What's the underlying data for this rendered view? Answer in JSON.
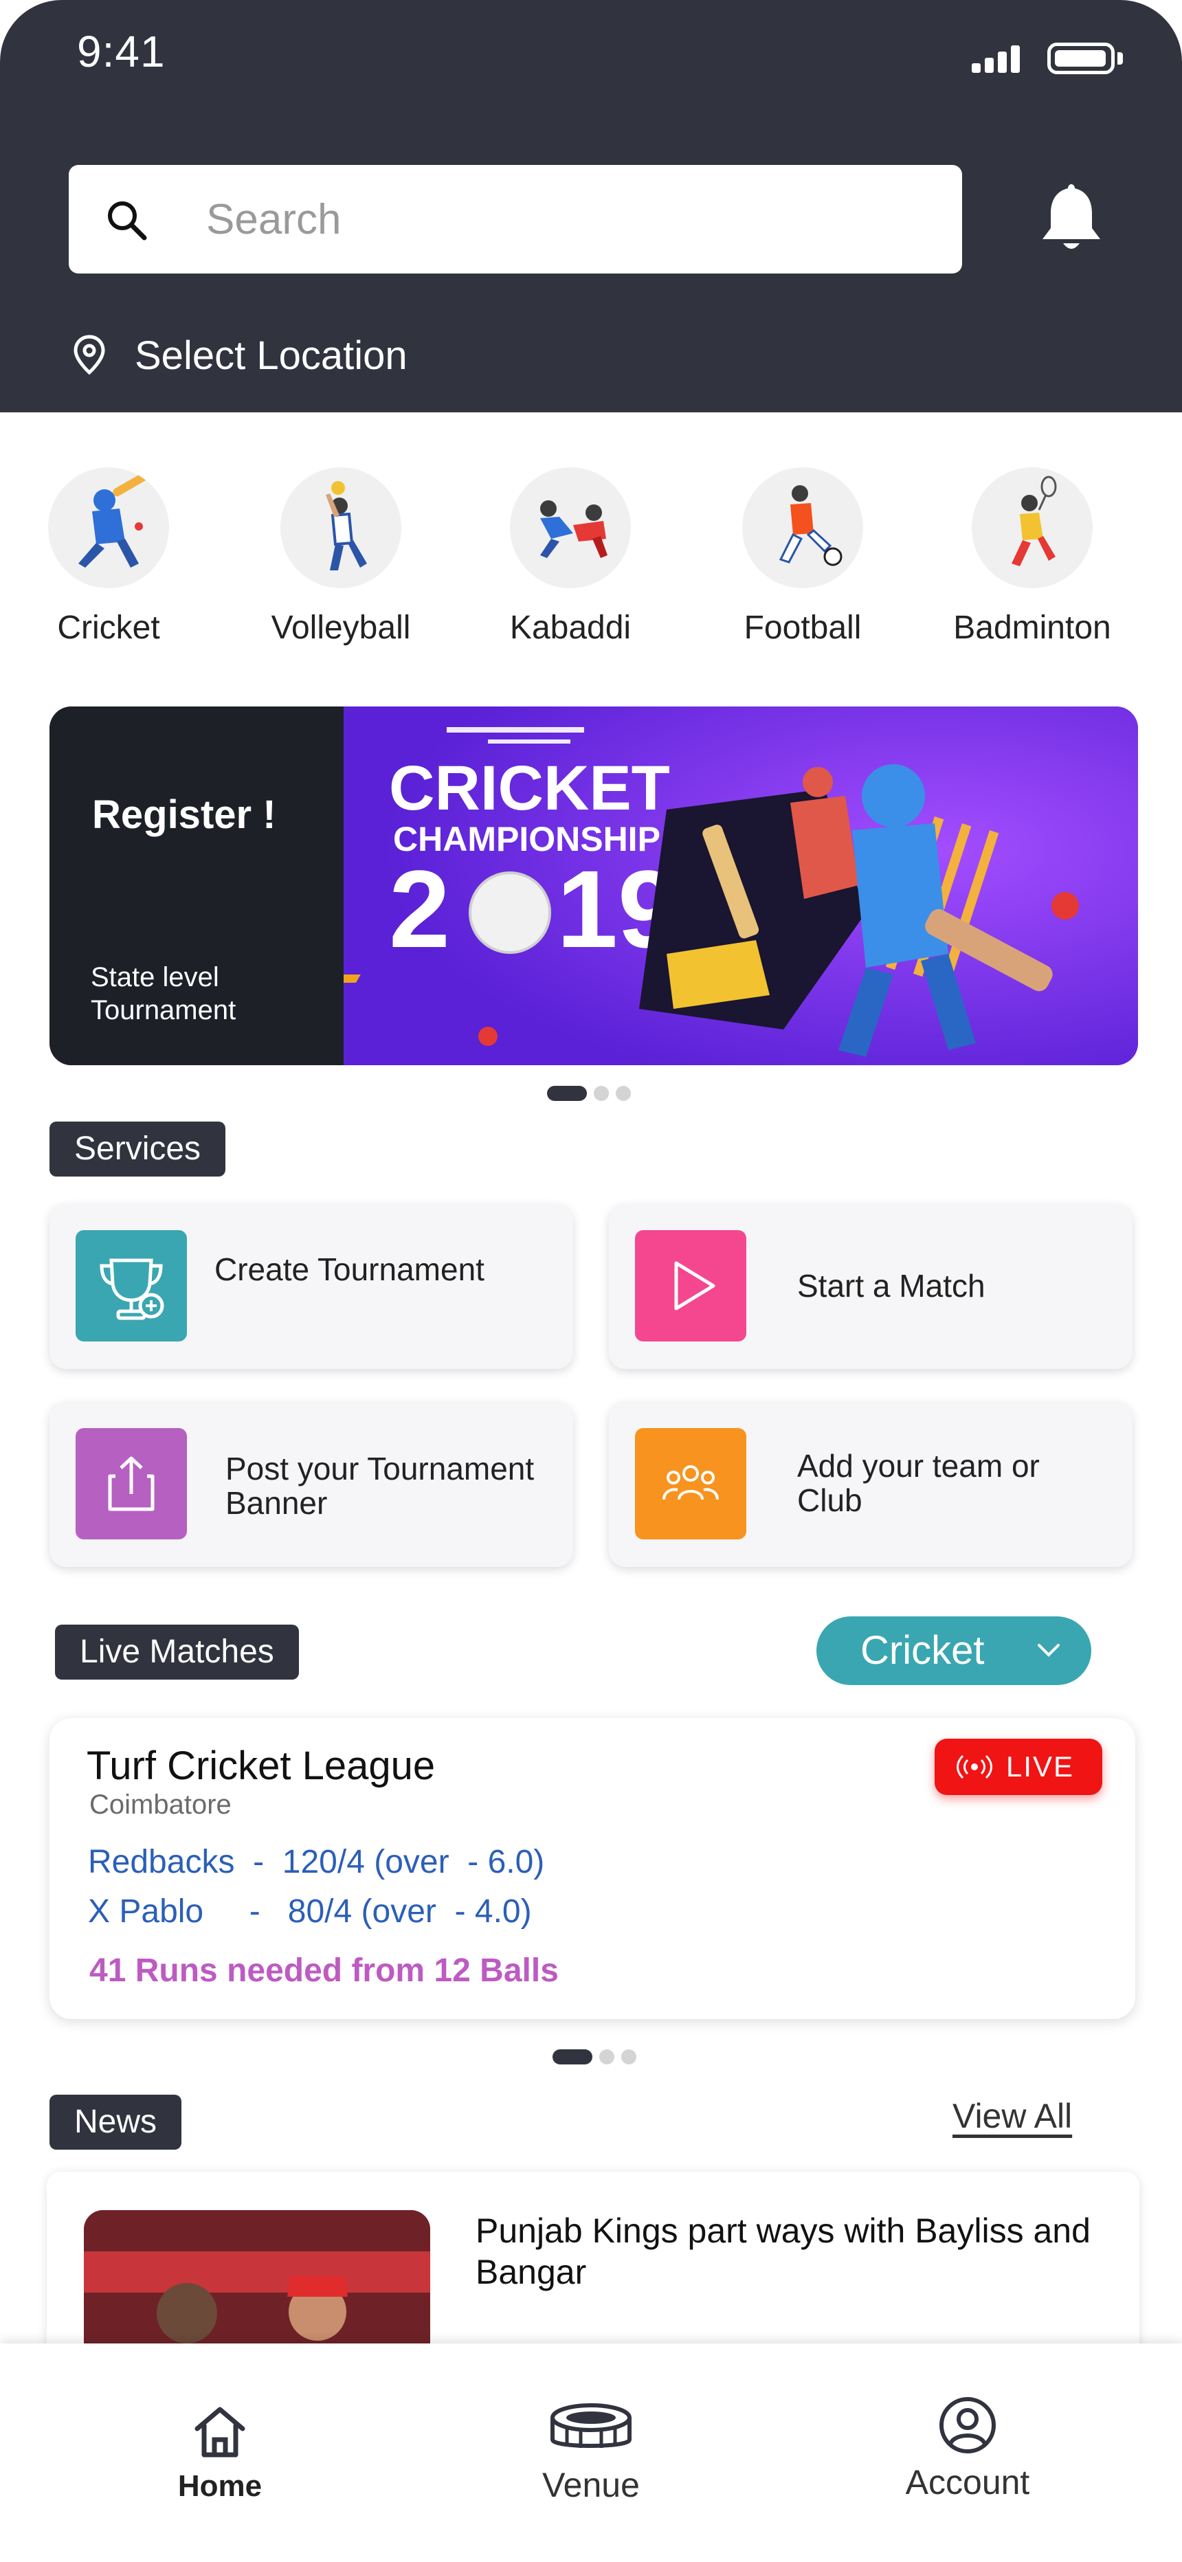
{
  "status_bar": {
    "time": "9:41"
  },
  "header": {
    "search_placeholder": "Search",
    "location_label": "Select Location"
  },
  "sports": [
    {
      "label": "Cricket",
      "icon": "cricket-player-icon"
    },
    {
      "label": "Volleyball",
      "icon": "volleyball-player-icon"
    },
    {
      "label": "Kabaddi",
      "icon": "kabaddi-players-icon"
    },
    {
      "label": "Football",
      "icon": "football-player-icon"
    },
    {
      "label": "Badminton",
      "icon": "badminton-player-icon"
    }
  ],
  "banner": {
    "title": "Register !",
    "subtitle": "State level Tournament",
    "image_heading": "CRICKET",
    "image_subheading": "CHAMPIONSHIP",
    "image_year_a": "2",
    "image_year_b": "19"
  },
  "services": {
    "tag": "Services",
    "items": [
      {
        "label": "Create Tournament",
        "icon": "trophy-icon",
        "color": "#3aa6b1"
      },
      {
        "label": "Start a Match",
        "icon": "play-icon",
        "color": "#f4478f"
      },
      {
        "label": "Post your Tournament Banner",
        "icon": "share-upload-icon",
        "color": "#b660c2"
      },
      {
        "label": "Add your team or Club",
        "icon": "team-icon",
        "color": "#f7931e"
      }
    ]
  },
  "live": {
    "tag": "Live Matches",
    "selected_sport": "Cricket",
    "match": {
      "title": "Turf Cricket League",
      "place": "Coimbatore",
      "badge": "LIVE",
      "team1": "Redbacks  -  120/4 (over  - 6.0)",
      "team2": "X Pablo     -   80/4 (over  - 4.0)",
      "needed": "41 Runs needed from 12 Balls"
    }
  },
  "news": {
    "tag": "News",
    "view_all": "View All",
    "item_title": "Punjab Kings part ways with Bayliss and Bangar"
  },
  "bottom_nav": {
    "home": "Home",
    "venue": "Venue",
    "account": "Account"
  },
  "colors": {
    "header_bg": "#31333f",
    "accent_teal": "#3aa6b1",
    "live_red": "#f01414",
    "team_blue": "#2b5fb8",
    "runs_purple": "#bd5bc2"
  }
}
